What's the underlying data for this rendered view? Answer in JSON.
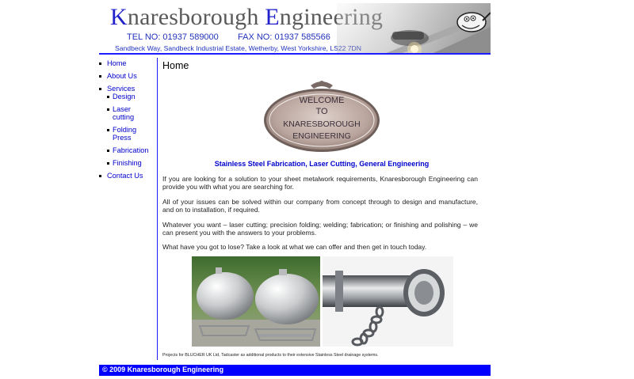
{
  "header": {
    "logo_first_cap": "K",
    "logo_first_rest": "naresborough ",
    "logo_second_cap": "E",
    "logo_second_rest": "ngineering",
    "tel": "TEL NO: 01937 589000",
    "fax": "FAX NO: 01937 585566",
    "address": "Sandbeck Way, Sandbeck Industrial Estate, Wetherby, West Yorkshire, LS22 7DN"
  },
  "nav": {
    "items": [
      {
        "label": "Home"
      },
      {
        "label": "About Us"
      },
      {
        "label": "Services"
      },
      {
        "label": "Contact Us"
      }
    ],
    "services_sub": [
      {
        "label": "Design"
      },
      {
        "label": "Laser cutting"
      },
      {
        "label": "Folding Press"
      },
      {
        "label": "Fabrication"
      },
      {
        "label": "Finishing"
      }
    ]
  },
  "main": {
    "page_title": "Home",
    "welcome_badge": {
      "line1": "WELCOME",
      "line2": "TO",
      "line3": "KNARESBOROUGH",
      "line4": "ENGINEERING"
    },
    "tagline": "Stainless Steel Fabrication, Laser Cutting, General Engineering",
    "paragraphs": [
      "If you are looking for a solution to your sheet metalwork requirements, Knaresborough Engineering can provide you with what you are searching for.",
      "All of your issues can be solved within our company from concept through to design and manufacture, and on to installation, if required.",
      "Whatever you want – laser cutting; precision folding; welding; fabrication; or finishing and polishing – we can present you with the answers to your problems.",
      "What have you got to lose?  Take a look at what we can offer and then get in touch today."
    ],
    "photo_caption": "Projects for BLUCHER UK Ltd, Tadcaster as additional products to their extensive Stainless Steel drainage systems."
  },
  "footer": {
    "copyright": "© 2009 Knaresborough Engineering"
  },
  "colors": {
    "link_blue": "#0000cc",
    "footer_bg": "#0000ff",
    "rule_blue": "#1c1cff",
    "logo_grey": "#5a5a5a"
  }
}
